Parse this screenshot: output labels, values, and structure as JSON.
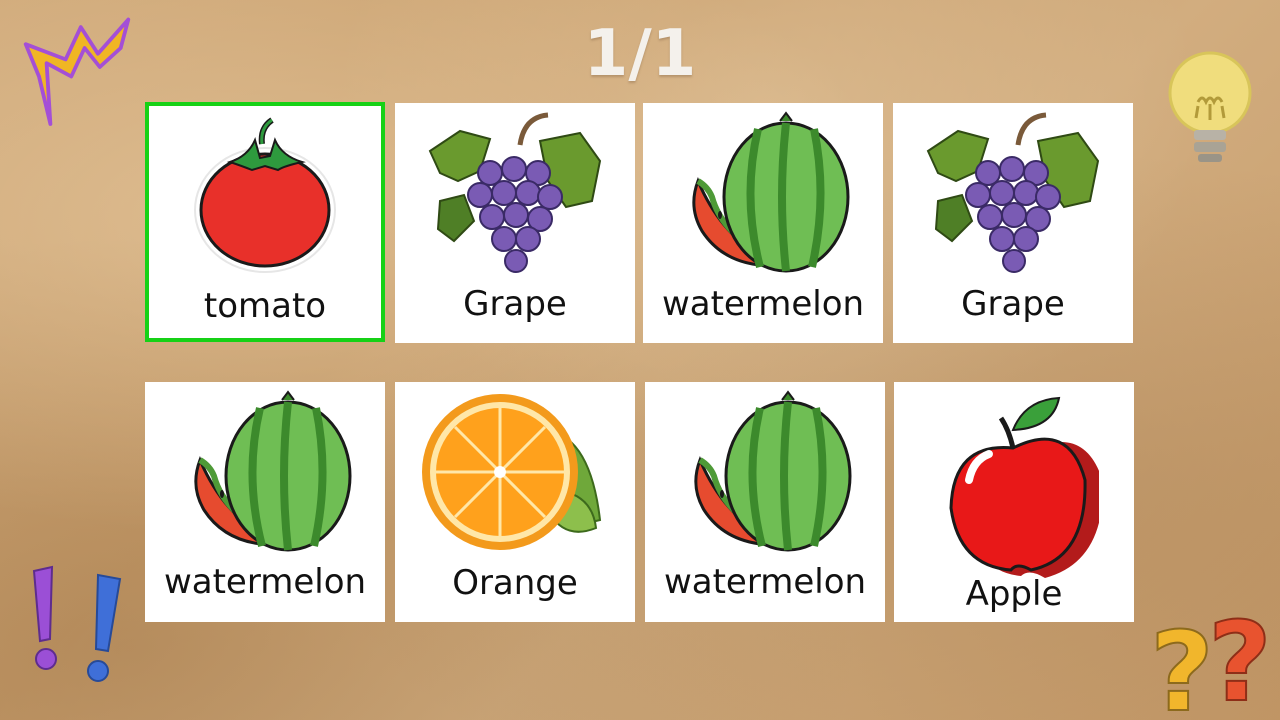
{
  "progress": {
    "text": "1/1"
  },
  "cards": [
    {
      "label": "tomato",
      "icon": "tomato-icon",
      "selected": true
    },
    {
      "label": "Grape",
      "icon": "grape-icon",
      "selected": false
    },
    {
      "label": "watermelon",
      "icon": "watermelon-icon",
      "selected": false
    },
    {
      "label": "Grape",
      "icon": "grape-icon",
      "selected": false
    },
    {
      "label": "watermelon",
      "icon": "watermelon-icon",
      "selected": false
    },
    {
      "label": "Orange",
      "icon": "orange-icon",
      "selected": false
    },
    {
      "label": "watermelon",
      "icon": "watermelon-icon",
      "selected": false
    },
    {
      "label": "Apple",
      "icon": "apple-icon",
      "selected": false
    }
  ],
  "decorations": [
    "zigzag-spark-icon",
    "lightbulb-icon",
    "exclamation-marks-icon",
    "question-marks-icon"
  ],
  "colors": {
    "selected_border": "#16d116",
    "card_bg": "#ffffff",
    "counter_text": "#f4f1ec"
  }
}
